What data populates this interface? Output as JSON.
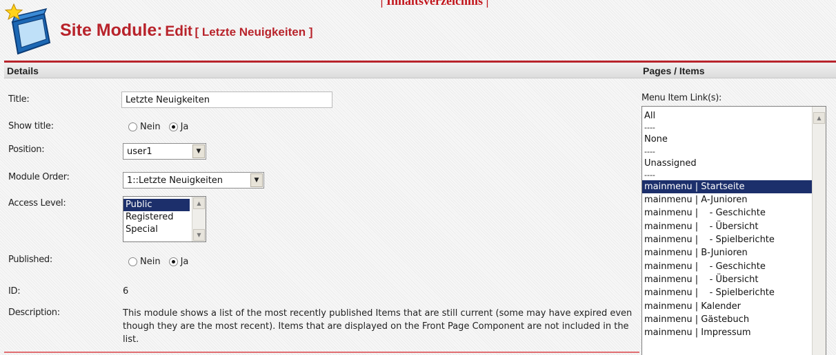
{
  "header": {
    "top_link": "| Inhaltsverzeichnis |",
    "title_main": "Site Module:",
    "title_action": "Edit",
    "title_item": "[ Letzte Neuigkeiten ]"
  },
  "details": {
    "header": "Details",
    "title_label": "Title:",
    "title_value": "Letzte Neuigkeiten",
    "show_title_label": "Show title:",
    "show_title_options": [
      "Nein",
      "Ja"
    ],
    "show_title_selected": "Ja",
    "position_label": "Position:",
    "position_value": "user1",
    "module_order_label": "Module Order:",
    "module_order_value": "1::Letzte Neuigkeiten",
    "access_level_label": "Access Level:",
    "access_level_options": [
      "Public",
      "Registered",
      "Special"
    ],
    "access_level_selected": "Public",
    "published_label": "Published:",
    "published_options": [
      "Nein",
      "Ja"
    ],
    "published_selected": "Ja",
    "id_label": "ID:",
    "id_value": "6",
    "description_label": "Description:",
    "description_value": "This module shows a list of the most recently published Items that are still current (some may have expired even though they are the most recent). Items that are displayed on the Front Page Component are not included in the list."
  },
  "pages": {
    "header": "Pages / Items",
    "menu_links_label": "Menu Item Link(s):",
    "menu_items": [
      "All",
      "----",
      "None",
      "----",
      "Unassigned",
      "----",
      "mainmenu | Startseite",
      "mainmenu | A-Junioren",
      "mainmenu |    - Geschichte",
      "mainmenu |    - Übersicht",
      "mainmenu |    - Spielberichte",
      "mainmenu | B-Junioren",
      "mainmenu |    - Geschichte",
      "mainmenu |    - Übersicht",
      "mainmenu |    - Spielberichte",
      "mainmenu | Kalender",
      "mainmenu | Gästebuch",
      "mainmenu | Impressum"
    ],
    "selected_item": "mainmenu | Startseite"
  },
  "icons": {
    "logo": "module-box-star-icon",
    "dropdown": "chevron-down-icon",
    "scroll_up": "scroll-up-arrow-icon",
    "scroll_down": "scroll-down-arrow-icon"
  },
  "colors": {
    "accent": "#b8232b",
    "selection": "#1c2f6b",
    "link": "#c1141b"
  }
}
